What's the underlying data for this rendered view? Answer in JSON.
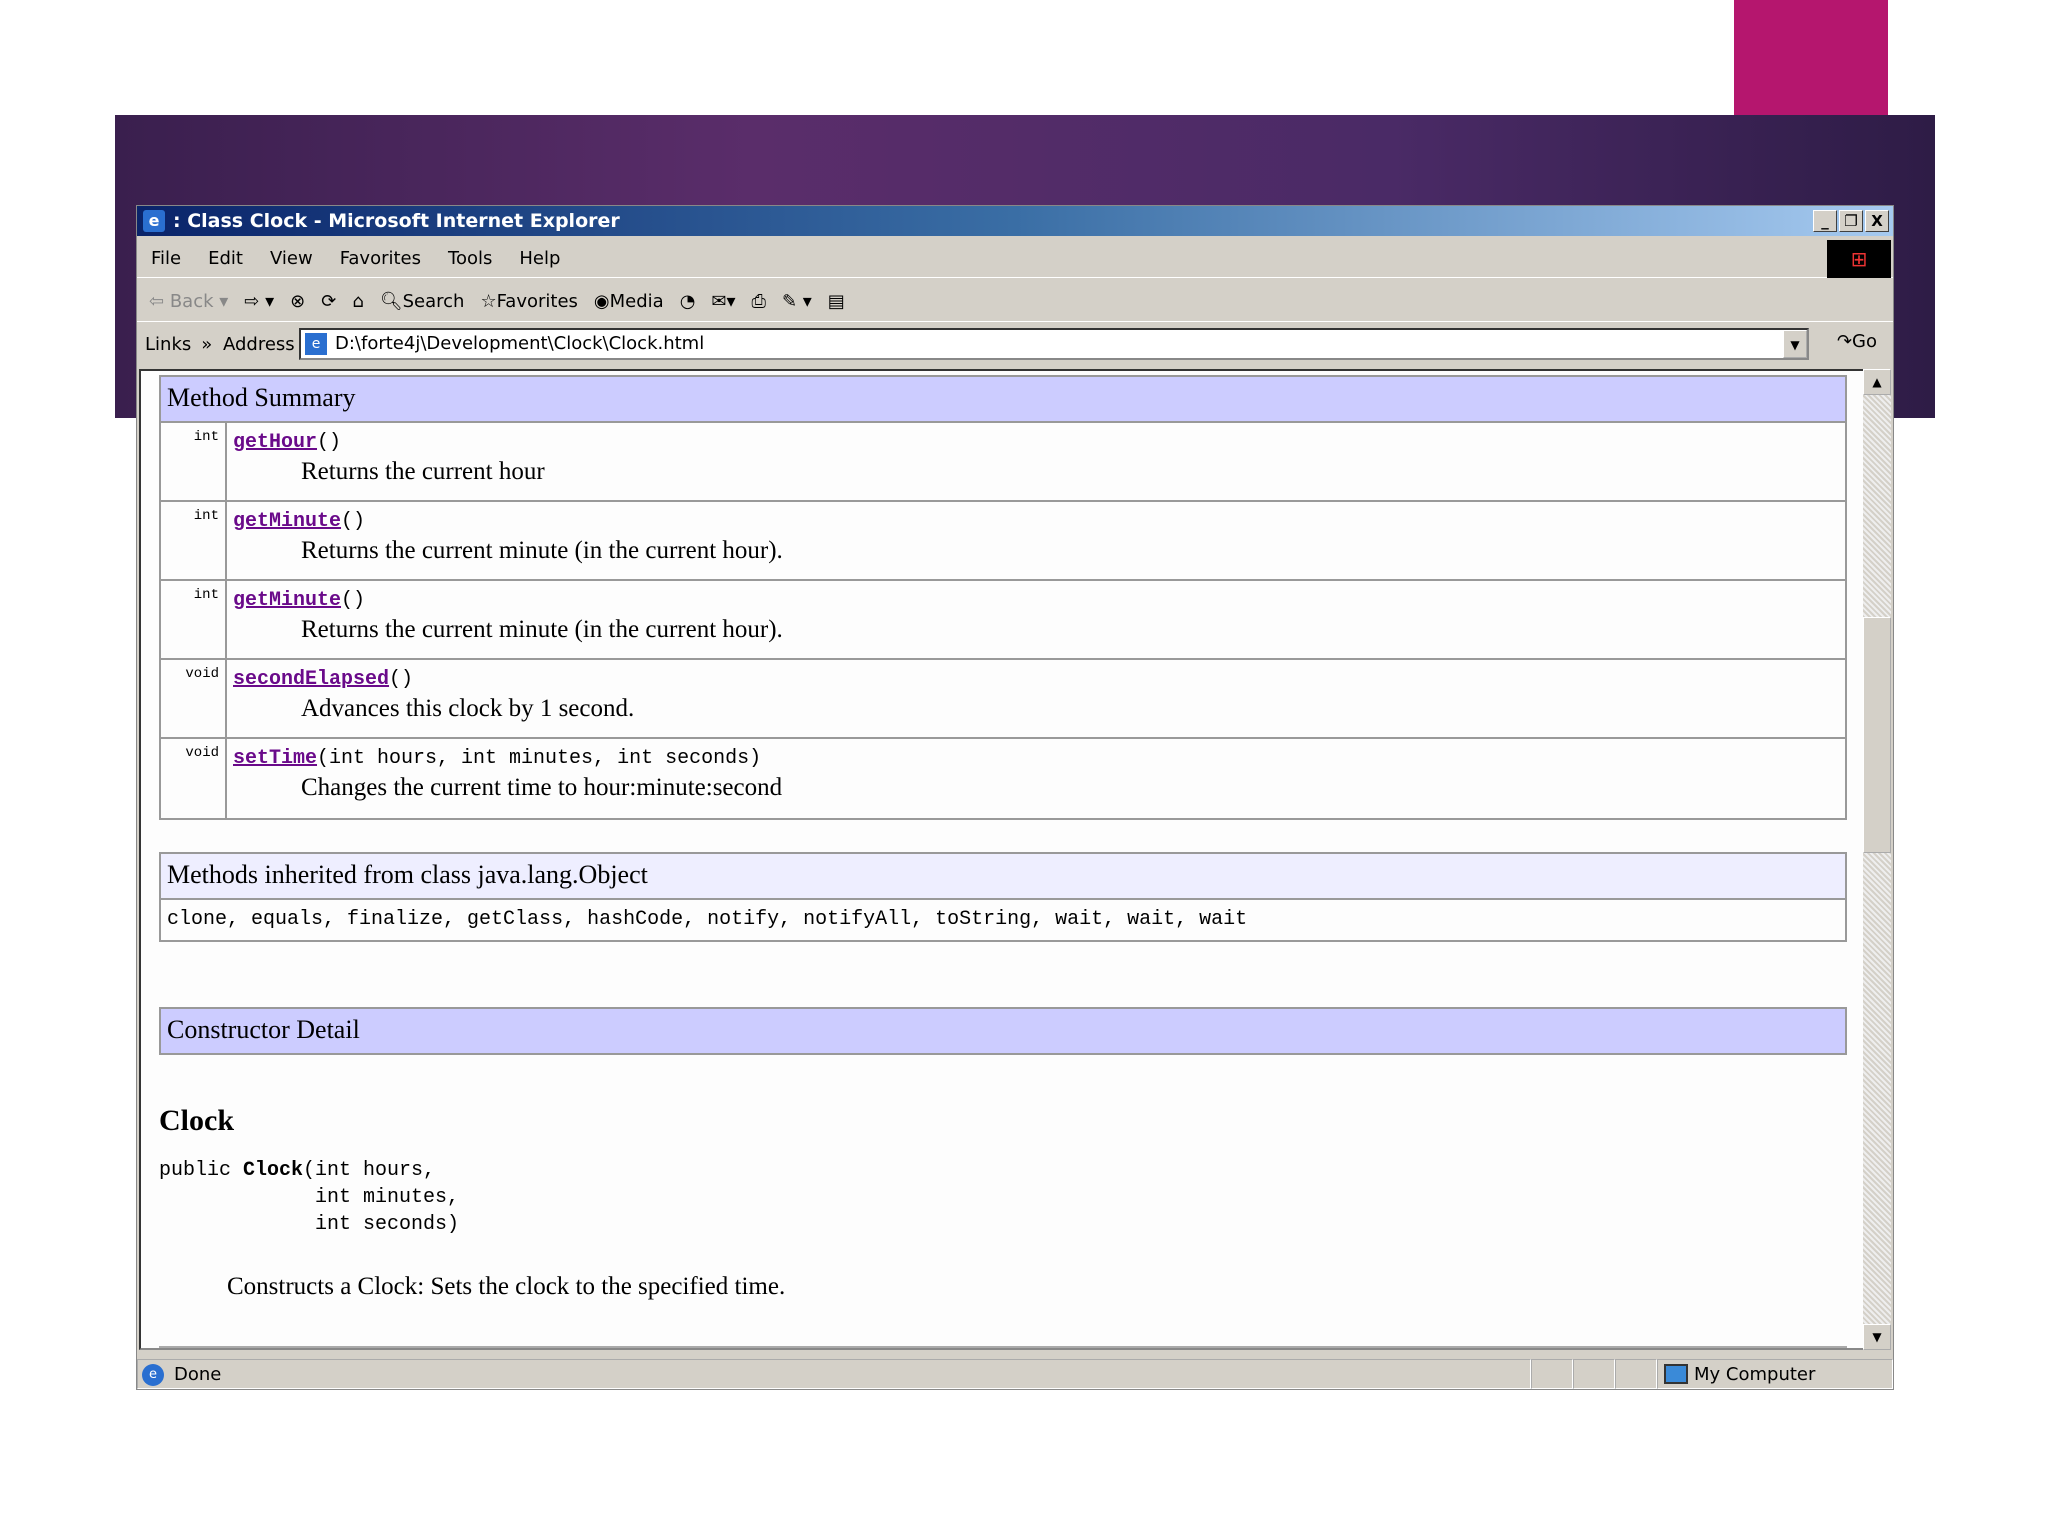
{
  "window": {
    "title": ": Class Clock - Microsoft Internet Explorer",
    "controls": [
      "_",
      "❐",
      "X"
    ]
  },
  "menu": [
    "File",
    "Edit",
    "View",
    "Favorites",
    "Tools",
    "Help"
  ],
  "toolbar": {
    "back": "Back",
    "search": "Search",
    "favorites": "Favorites",
    "media": "Media"
  },
  "address": {
    "links": "Links",
    "chevron": "»",
    "label": "Address",
    "url": "D:\\forte4j\\Development\\Clock\\Clock.html",
    "go": "Go"
  },
  "method_summary": {
    "title": "Method Summary",
    "rows": [
      {
        "type": "int",
        "name": "getHour",
        "params": "()",
        "desc": "Returns the current hour"
      },
      {
        "type": "int",
        "name": "getMinute",
        "params": "()",
        "desc": "Returns the current minute (in the current hour)."
      },
      {
        "type": "int",
        "name": "getMinute",
        "params": "()",
        "desc": "Returns the current minute (in the current hour)."
      },
      {
        "type": "void",
        "name": "secondElapsed",
        "params": "()",
        "desc": "Advances this clock by 1 second."
      },
      {
        "type": "void",
        "name": "setTime",
        "params": "(int hours, int minutes, int seconds)",
        "desc": "Changes the current time to hour:minute:second"
      }
    ]
  },
  "inherited": {
    "title": "Methods inherited from class java.lang.Object",
    "methods": "clone, equals, finalize, getClass, hashCode, notify, notifyAll, toString, wait, wait, wait"
  },
  "constructor": {
    "title": "Constructor Detail",
    "name": "Clock",
    "sig_prefix": "public ",
    "sig_name": "Clock",
    "sig_rest": "(int hours,\n             int minutes,\n             int seconds)",
    "desc": "Constructs a Clock: Sets the clock to the specified time."
  },
  "status": {
    "text": "Done",
    "zone": "My Computer"
  }
}
